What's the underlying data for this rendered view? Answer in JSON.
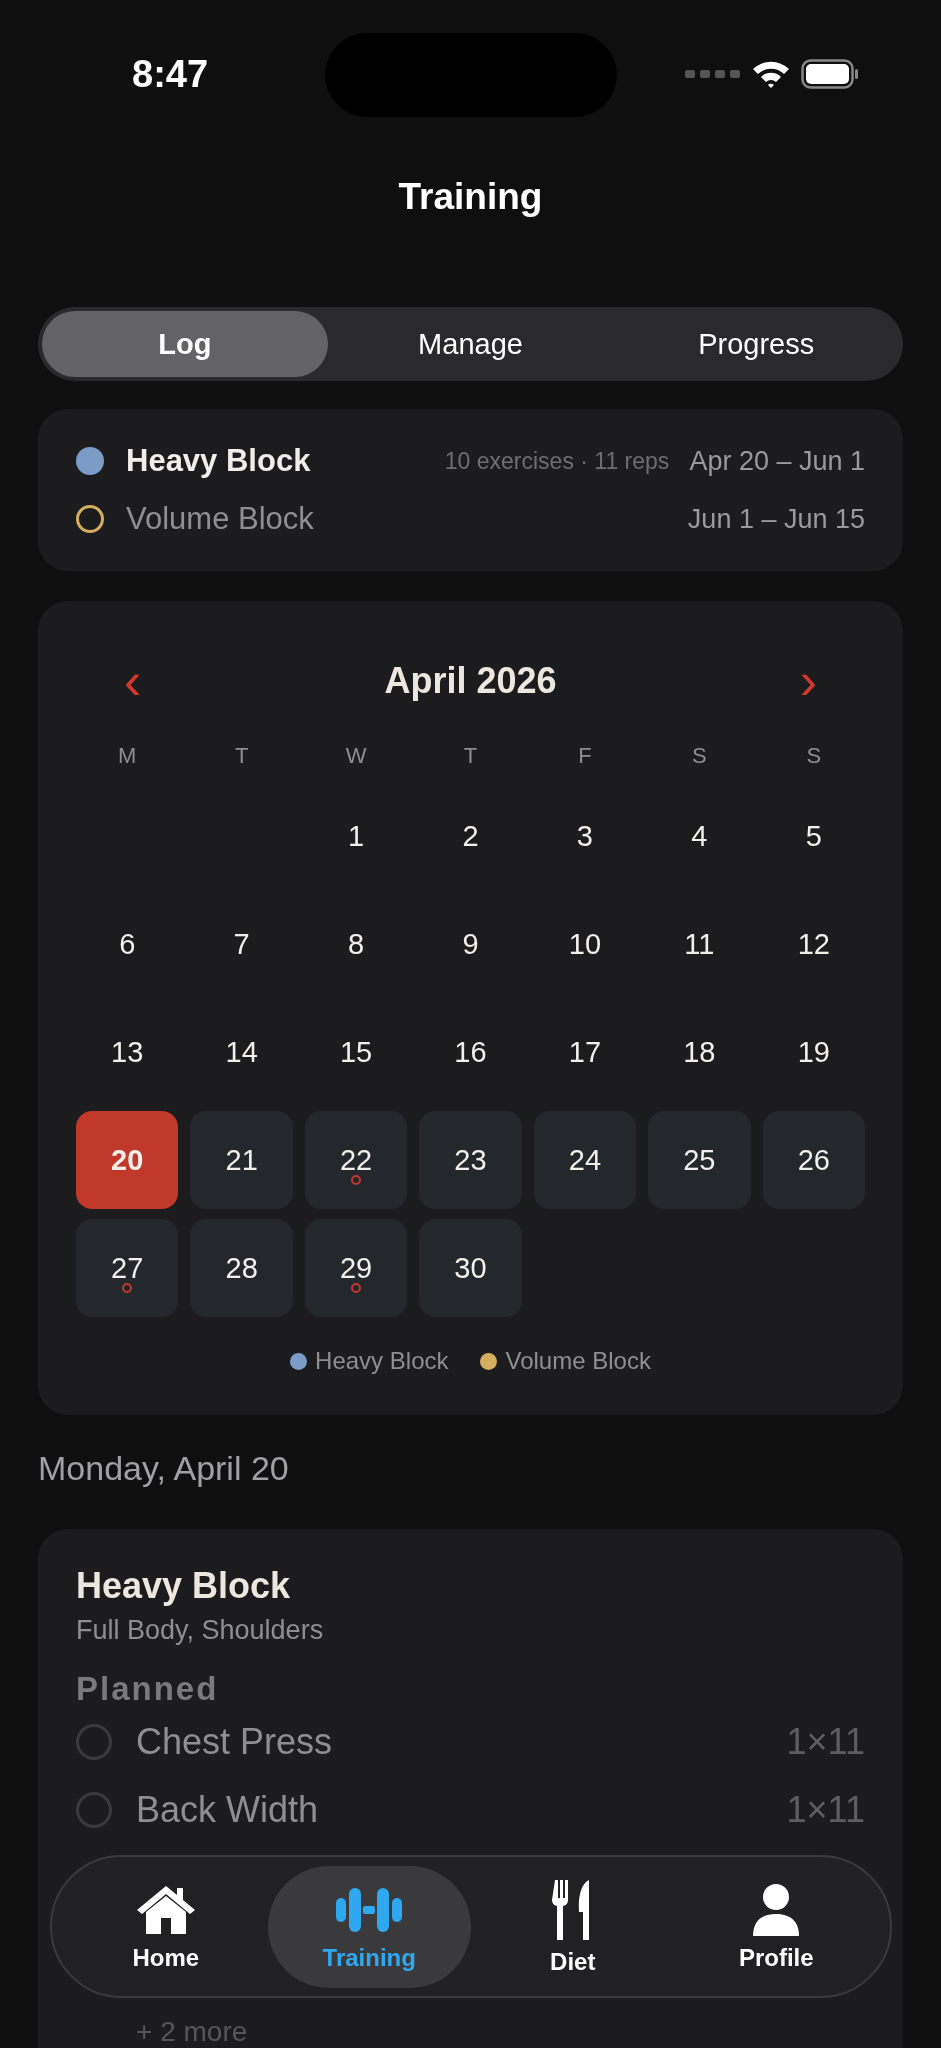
{
  "status_bar": {
    "time": "8:47"
  },
  "title": "Training",
  "tabs": [
    {
      "label": "Log",
      "selected": true
    },
    {
      "label": "Manage",
      "selected": false
    },
    {
      "label": "Progress",
      "selected": false
    }
  ],
  "blocks": [
    {
      "name": "Heavy Block",
      "color": "#7a9cc6",
      "active": true,
      "meta": "10 exercises · 11 reps",
      "dates": "Apr 20 – Jun 1"
    },
    {
      "name": "Volume Block",
      "color": "#d4ae5f",
      "active": false,
      "dates": "Jun 1 – Jun 15"
    }
  ],
  "calendar": {
    "month": "April 2026",
    "prev": "‹",
    "next": "›",
    "weekdays": [
      "M",
      "T",
      "W",
      "T",
      "F",
      "S",
      "S"
    ],
    "weeks": [
      [
        {
          "day": "1",
          "scheduled": false,
          "selected": false,
          "marked": false
        },
        {
          "day": "2",
          "scheduled": false,
          "selected": false,
          "marked": false
        },
        {
          "day": "3",
          "scheduled": false,
          "selected": false,
          "marked": false
        },
        {
          "day": "4",
          "scheduled": false,
          "selected": false,
          "marked": false
        },
        {
          "day": "5",
          "scheduled": false,
          "selected": false,
          "marked": false
        }
      ],
      [
        {
          "day": "6",
          "scheduled": false,
          "selected": false,
          "marked": false
        },
        {
          "day": "7",
          "scheduled": false,
          "selected": false,
          "marked": false
        },
        {
          "day": "8",
          "scheduled": false,
          "selected": false,
          "marked": false
        },
        {
          "day": "9",
          "scheduled": false,
          "selected": false,
          "marked": false
        },
        {
          "day": "10",
          "scheduled": false,
          "selected": false,
          "marked": false
        },
        {
          "day": "11",
          "scheduled": false,
          "selected": false,
          "marked": false
        },
        {
          "day": "12",
          "scheduled": false,
          "selected": false,
          "marked": false
        }
      ],
      [
        {
          "day": "13",
          "scheduled": false,
          "selected": false,
          "marked": false
        },
        {
          "day": "14",
          "scheduled": false,
          "selected": false,
          "marked": false
        },
        {
          "day": "15",
          "scheduled": false,
          "selected": false,
          "marked": false
        },
        {
          "day": "16",
          "scheduled": false,
          "selected": false,
          "marked": false
        },
        {
          "day": "17",
          "scheduled": false,
          "selected": false,
          "marked": false
        },
        {
          "day": "18",
          "scheduled": false,
          "selected": false,
          "marked": false
        },
        {
          "day": "19",
          "scheduled": false,
          "selected": false,
          "marked": false
        }
      ],
      [
        {
          "day": "20",
          "scheduled": true,
          "selected": true,
          "marked": false
        },
        {
          "day": "21",
          "scheduled": true,
          "selected": false,
          "marked": false
        },
        {
          "day": "22",
          "scheduled": true,
          "selected": false,
          "marked": true
        },
        {
          "day": "23",
          "scheduled": true,
          "selected": false,
          "marked": false
        },
        {
          "day": "24",
          "scheduled": true,
          "selected": false,
          "marked": false
        },
        {
          "day": "25",
          "scheduled": true,
          "selected": false,
          "marked": false
        },
        {
          "day": "26",
          "scheduled": true,
          "selected": false,
          "marked": false
        }
      ],
      [
        {
          "day": "27",
          "scheduled": true,
          "selected": false,
          "marked": true
        },
        {
          "day": "28",
          "scheduled": true,
          "selected": false,
          "marked": false
        },
        {
          "day": "29",
          "scheduled": true,
          "selected": false,
          "marked": true
        },
        {
          "day": "30",
          "scheduled": true,
          "selected": false,
          "marked": false
        }
      ]
    ],
    "legend": [
      {
        "label": "Heavy Block",
        "color": "#7a9cc6"
      },
      {
        "label": "Volume Block",
        "color": "#d4ae5f"
      }
    ]
  },
  "day_heading": "Monday, April 20",
  "workout": {
    "title": "Heavy Block",
    "subtitle": "Full Body, Shoulders",
    "section": "Planned",
    "exercises": [
      {
        "name": "Chest Press",
        "sets": "1×11",
        "checked": false
      },
      {
        "name": "Back Width",
        "sets": "1×11",
        "checked": false
      }
    ],
    "more": "+ 2 more"
  },
  "tab_bar": [
    {
      "label": "Home",
      "selected": false
    },
    {
      "label": "Training",
      "selected": true
    },
    {
      "label": "Diet",
      "selected": false
    },
    {
      "label": "Profile",
      "selected": false
    }
  ]
}
